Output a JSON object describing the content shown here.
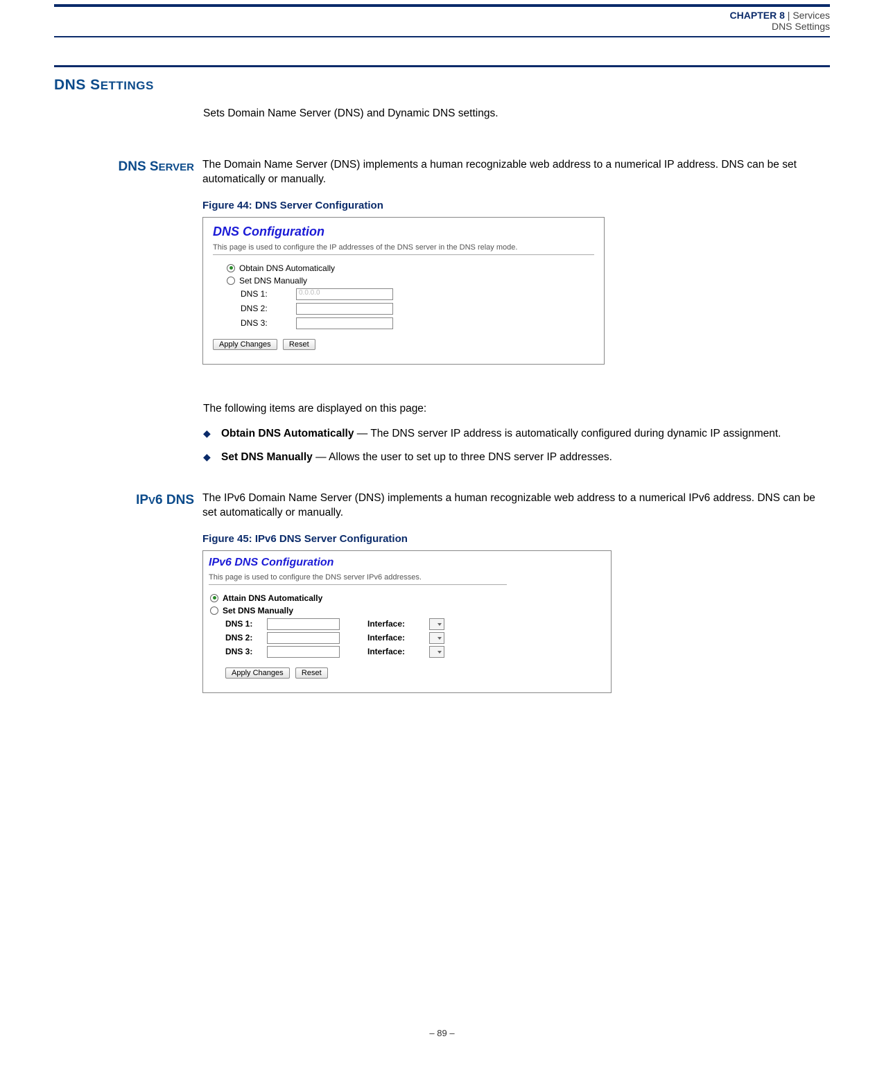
{
  "header": {
    "chapter_label": "CHAPTER 8",
    "sep": "  |  ",
    "services": "Services",
    "subtitle": "DNS Settings"
  },
  "section": {
    "title_main": "DNS S",
    "title_sc": "ETTINGS",
    "intro": "Sets Domain Name Server (DNS) and Dynamic DNS settings."
  },
  "dns_server": {
    "side_main": "DNS S",
    "side_sc": "ERVER",
    "para": "The Domain Name Server (DNS) implements a human recognizable web address to a numerical IP address. DNS can be set automatically or manually.",
    "fig_caption": "Figure 44:  DNS Server Configuration",
    "ss": {
      "title": "DNS Configuration",
      "desc": "This page is used to configure the IP addresses of the DNS server in the DNS relay mode.",
      "opt_auto": "Obtain DNS Automatically",
      "opt_manual": "Set DNS Manually",
      "dns1_label": "DNS 1:",
      "dns2_label": "DNS 2:",
      "dns3_label": "DNS 3:",
      "dns1_value": "0.0.0.0",
      "dns2_value": "",
      "dns3_value": "",
      "btn_apply": "Apply Changes",
      "btn_reset": "Reset"
    },
    "items_lead": "The following items are displayed on this page:",
    "bullets": [
      {
        "term": "Obtain DNS Automatically",
        "desc": " — The DNS server IP address is automatically configured during dynamic IP assignment."
      },
      {
        "term": "Set DNS Manually",
        "desc": " — Allows the user to set up to three DNS server IP addresses."
      }
    ]
  },
  "ipv6_dns": {
    "side_pre": "IP",
    "side_sc1": "V",
    "side_post": "6 DNS",
    "para": "The IPv6 Domain Name Server (DNS) implements a human recognizable web address to a numerical IPv6 address. DNS can be set automatically or manually.",
    "fig_caption": "Figure 45:  IPv6 DNS Server Configuration",
    "ss": {
      "title": "IPv6 DNS Configuration",
      "desc": "This page is used to configure the DNS server IPv6 addresses.",
      "opt_auto": "Attain DNS Automatically",
      "opt_manual": "Set DNS Manually",
      "dns1_label": "DNS 1:",
      "dns2_label": "DNS 2:",
      "dns3_label": "DNS 3:",
      "iface_label": "Interface:",
      "btn_apply": "Apply Changes",
      "btn_reset": "Reset"
    }
  },
  "footer": {
    "page": "–  89  –"
  }
}
